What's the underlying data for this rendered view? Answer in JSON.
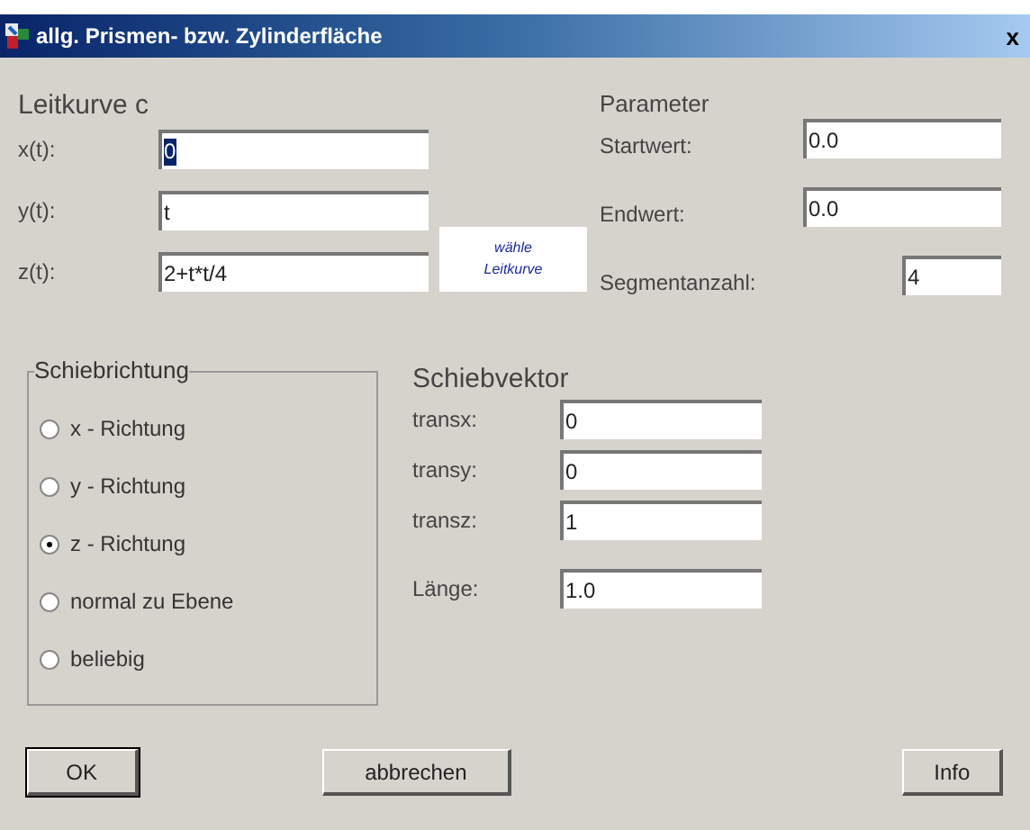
{
  "window": {
    "title": "allg. Prismen- bzw. Zylinderfläche",
    "close": "x"
  },
  "leitkurve": {
    "title": "Leitkurve c",
    "fields": [
      {
        "label": "x(t):",
        "value": "0",
        "focused": true
      },
      {
        "label": "y(t):",
        "value": "t",
        "focused": false
      },
      {
        "label": "z(t):",
        "value": "2+t*t/4",
        "focused": false
      }
    ],
    "choose_button": [
      "wähle",
      "Leitkurve"
    ]
  },
  "parameter": {
    "title": "Parameter",
    "fields": [
      {
        "label": "Startwert:",
        "value": "0.0",
        "wide": true
      },
      {
        "label": "Endwert:",
        "value": "0.0",
        "wide": true
      },
      {
        "label": "Segmentanzahl:",
        "value": "4",
        "wide": false
      }
    ]
  },
  "schiebrichtung": {
    "title": "Schiebrichtung",
    "options": [
      {
        "label": "x - Richtung",
        "selected": false
      },
      {
        "label": "y - Richtung",
        "selected": false
      },
      {
        "label": "z - Richtung",
        "selected": true
      },
      {
        "label": "normal zu Ebene",
        "selected": false
      },
      {
        "label": "beliebig",
        "selected": false
      }
    ]
  },
  "schiebvektor": {
    "title": "Schiebvektor",
    "fields": [
      {
        "label": "transx:",
        "value": "0"
      },
      {
        "label": "transy:",
        "value": "0"
      },
      {
        "label": "transz:",
        "value": "1"
      },
      {
        "label": "Länge:",
        "value": "1.0"
      }
    ]
  },
  "buttons": [
    {
      "label": "OK",
      "default": true
    },
    {
      "label": "abbrechen",
      "default": false
    },
    {
      "label": "Info",
      "default": false
    }
  ]
}
